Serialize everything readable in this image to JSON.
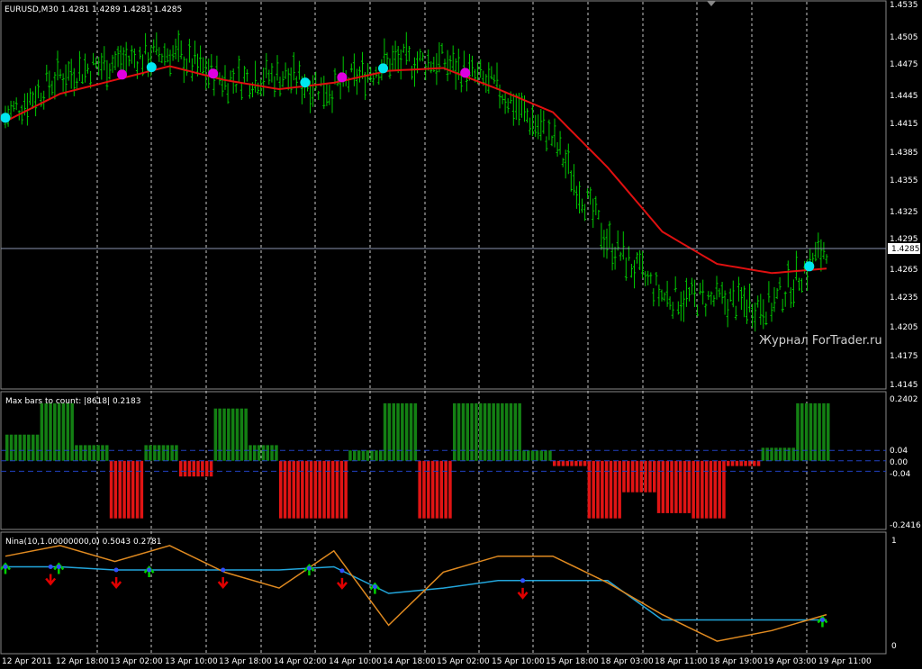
{
  "colors": {
    "background": "#000000",
    "grid": "#c8c8c8",
    "price_bars": "#00c800",
    "ma_line": "#e01010",
    "marker_buy": "#00e6f0",
    "marker_sell": "#e000e0",
    "hist_pos": "#138013",
    "hist_neg": "#e01414",
    "level_line": "#2040c0",
    "nina_fast": "#e08a20",
    "nina_slow": "#22a6dc",
    "arrow_down": "#e00000",
    "arrow_up": "#00d000"
  },
  "header": {
    "title": "EURUSD,M30  1.4281 1.4289 1.4281 1.4285"
  },
  "watermark": "Журнал ForTrader.ru",
  "main_panel": {
    "current_price": "1.4285",
    "y_ticks": [
      "1.4535",
      "1.4505",
      "1.4475",
      "1.4445",
      "1.4415",
      "1.4385",
      "1.4355",
      "1.4325",
      "1.4295",
      "1.4265",
      "1.4235",
      "1.4205",
      "1.4175",
      "1.4145"
    ]
  },
  "hist_panel": {
    "title": "Max bars to count: |8618|  0.2183",
    "y_ticks": [
      "0.2402",
      "0.04",
      "0.00",
      "-0.04",
      "-0.2416"
    ]
  },
  "nina_panel": {
    "title": "Nina(10,1.00000000,0) 0.5043 0.2781",
    "y_ticks": [
      "1",
      "0"
    ]
  },
  "x_ticks": [
    "12 Apr 2011",
    "12 Apr 18:00",
    "13 Apr 02:00",
    "13 Apr 10:00",
    "13 Apr 18:00",
    "14 Apr 02:00",
    "14 Apr 10:00",
    "14 Apr 18:00",
    "15 Apr 02:00",
    "15 Apr 10:00",
    "15 Apr 18:00",
    "18 Apr 03:00",
    "18 Apr 11:00",
    "18 Apr 19:00",
    "19 Apr 03:00",
    "19 Apr 11:00"
  ],
  "chart_data": {
    "type": "line",
    "title": "EURUSD,M30",
    "x": [
      "12 Apr 2011",
      "12 Apr 18:00",
      "13 Apr 02:00",
      "13 Apr 10:00",
      "13 Apr 18:00",
      "14 Apr 02:00",
      "14 Apr 10:00",
      "14 Apr 18:00",
      "15 Apr 02:00",
      "15 Apr 10:00",
      "15 Apr 18:00",
      "18 Apr 03:00",
      "18 Apr 11:00",
      "18 Apr 19:00",
      "19 Apr 03:00",
      "19 Apr 11:00"
    ],
    "ylim": [
      1.413,
      1.455
    ],
    "series": [
      {
        "values": [
          1.4425,
          1.447,
          1.4485,
          1.4495,
          1.4465,
          1.447,
          1.4455,
          1.4485,
          1.4485,
          1.4455,
          1.44,
          1.429,
          1.423,
          1.4225,
          1.422,
          1.4285
        ]
      },
      {
        "values": [
          1.442,
          1.445,
          1.4465,
          1.448,
          1.4465,
          1.4455,
          1.4462,
          1.4475,
          1.4478,
          1.4455,
          1.443,
          1.437,
          1.43,
          1.4265,
          1.4255,
          1.426
        ]
      }
    ],
    "histogram": {
      "ylim": [
        -0.2416,
        0.2402
      ],
      "levels": [
        0.04,
        0.0,
        -0.04
      ],
      "values": [
        0.1,
        0.22,
        0.06,
        -0.22,
        0.06,
        -0.06,
        0.2,
        0.06,
        -0.22,
        -0.22,
        0.04,
        0.22,
        -0.22,
        0.22,
        0.22,
        0.04,
        -0.02,
        -0.22,
        -0.12,
        -0.2,
        -0.22,
        -0.02,
        0.05,
        0.22
      ]
    },
    "nina": {
      "ylim": [
        0,
        1
      ],
      "fast": [
        0.85,
        0.95,
        0.8,
        0.95,
        0.7,
        0.55,
        0.9,
        0.2,
        0.7,
        0.85,
        0.85,
        0.6,
        0.3,
        0.05,
        0.15,
        0.3
      ],
      "slow": [
        0.75,
        0.75,
        0.72,
        0.72,
        0.72,
        0.72,
        0.75,
        0.5,
        0.55,
        0.62,
        0.62,
        0.62,
        0.25,
        0.25,
        0.25,
        0.25
      ]
    }
  }
}
